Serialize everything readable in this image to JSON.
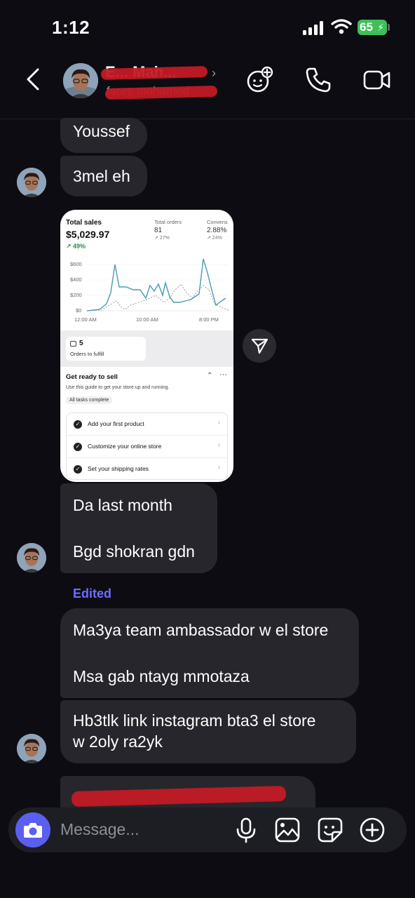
{
  "status_bar": {
    "time": "1:12",
    "battery": "65"
  },
  "header": {
    "name": "E... Mah...",
    "subtitle": "fares mohamed"
  },
  "messages": [
    {
      "text": "Youssef"
    },
    {
      "text": "3mel eh"
    },
    {
      "line1": "Da last month",
      "line2": "Bgd shokran gdn"
    },
    {
      "edited": "Edited"
    },
    {
      "line1": "Ma3ya team ambassador w el store",
      "line2": "Msa gab ntayg mmotaza"
    },
    {
      "line1": "Hb3tlk link instagram bta3 el store",
      "line2": "w 2oly ra2yk"
    }
  ],
  "screenshot_card": {
    "total_sales_label": "Total sales",
    "total_sales_value": "$5,029.97",
    "total_sales_change": "↗ 49%",
    "total_orders_label": "Total orders",
    "total_orders_value": "81",
    "total_orders_change": "↗ 27%",
    "conversion_label": "Conversi",
    "conversion_value": "2.88%",
    "conversion_change": "↗ 24%",
    "y_ticks": [
      "$600",
      "$400",
      "$200",
      "$0"
    ],
    "x_ticks": [
      "12:00 AM",
      "10:00 AM",
      "8:00 PM"
    ],
    "orders_count": "5",
    "orders_label": "Orders to fulfill",
    "guide_title": "Get ready to sell",
    "guide_subtitle": "Use this guide to get your store up and running.",
    "guide_badge": "All tasks complete",
    "tasks": [
      "Add your first product",
      "Customize your online store",
      "Set your shipping rates"
    ]
  },
  "composer": {
    "placeholder": "Message..."
  },
  "colors": {
    "background": "#0c0c12",
    "bubble": "#26262c",
    "accent": "#5b5ff0",
    "edited": "#6d6dff",
    "battery": "#3fbf5a"
  }
}
